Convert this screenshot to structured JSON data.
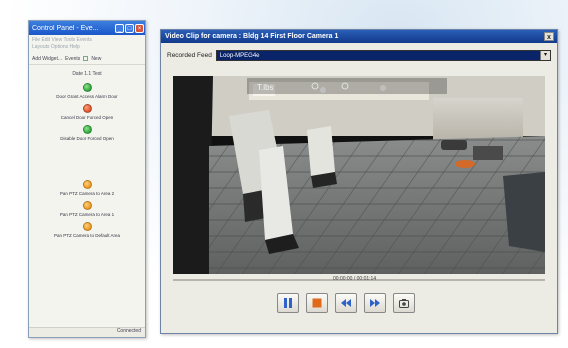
{
  "events_window": {
    "title": "Control Panel - Eve...",
    "menu_lines": [
      "File  Edit  View  Tools  Events",
      "Layouts  Options  Help"
    ],
    "toolbar": {
      "dropdown": "Add Widget...",
      "filter": "Events",
      "checkbox_label": "New"
    },
    "date": "Date 1.1 Test",
    "events": [
      {
        "label": "Door Grant Access Alarm Door",
        "color": "#2faa3a"
      },
      {
        "label": "Cancel Door Forced Open",
        "color": "#e2542e"
      },
      {
        "label": "Disable Door Forced Open",
        "color": "#2faa3a"
      },
      {
        "label": "Pan PTZ Camera to Area 2",
        "color": "#f0981e"
      },
      {
        "label": "Pan PTZ Camera to Area 1",
        "color": "#f0981e"
      },
      {
        "label": "Pan PTZ Camera to Default Area",
        "color": "#f0981e"
      }
    ],
    "footer": "Connected"
  },
  "video_window": {
    "title": "Video Clip for camera : Bldg 14 First Floor Camera 1",
    "close_label": "x",
    "feed_label": "Recorded Feed",
    "feed_value": "Loop-MPEG4e",
    "timestamp": "00:00:00 / 00:01:14",
    "controls": [
      {
        "name": "pause-button",
        "icon": "pause-icon"
      },
      {
        "name": "stop-button",
        "icon": "stop-icon"
      },
      {
        "name": "rewind-button",
        "icon": "rewind-icon"
      },
      {
        "name": "fast-forward-button",
        "icon": "fast-forward-icon"
      },
      {
        "name": "snapshot-button",
        "icon": "camera-icon"
      }
    ],
    "colors": {
      "accent": "#1a56c8",
      "control_icon": "#2f62c8",
      "stop_icon": "#e06a1a"
    }
  }
}
